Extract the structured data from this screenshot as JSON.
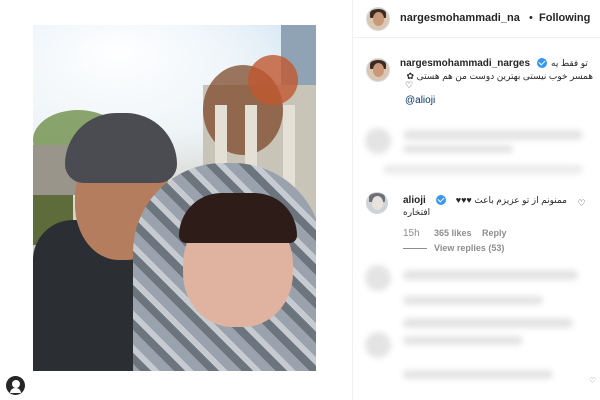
{
  "header": {
    "username": "nargesmohammadi_na",
    "separator": "•",
    "follow_label": "Following"
  },
  "caption": {
    "username": "nargesmohammadi_narges",
    "line1": "تو فقط یه",
    "line2": "همسر خوب نیستی بهترین دوست من هم هستی ✿",
    "line3": "♡",
    "mention": "@alioji"
  },
  "comment": {
    "username": "alioji",
    "line1": "ممنونم از تو عزیزم باعث ♥♥♥",
    "line2": "افتخاره",
    "time": "15h",
    "likes": "365 likes",
    "reply_label": "Reply",
    "view_replies": "View replies (53)"
  },
  "icons": {
    "verified": "verified-badge-icon",
    "heart": "heart-outline-icon",
    "profile": "user-profile-icon"
  },
  "colors": {
    "link": "#003569",
    "verified": "#3897f0",
    "muted": "#8e8e8e"
  }
}
